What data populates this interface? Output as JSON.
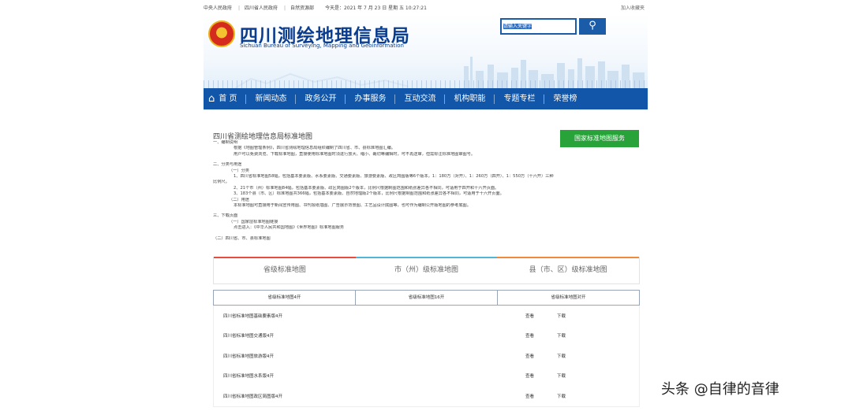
{
  "topbar": {
    "links": [
      "中央人民政府",
      "四川省人民政府",
      "自然资源部"
    ],
    "date": "今天是：2021 年 7 月 23 日 星期 五   10:27:21",
    "favorite": "加入收藏夹"
  },
  "header": {
    "title": "四川测绘地理信息局",
    "subtitle": "Sichuan Bureau of Surveying, Mapping and Geoinformation",
    "search_placeholder": "请输入关键字",
    "search_icon": "search-icon"
  },
  "nav": {
    "items": [
      "首 页",
      "新闻动态",
      "政务公开",
      "办事服务",
      "互动交流",
      "机构职能",
      "专题专栏",
      "荣誉榜"
    ]
  },
  "content": {
    "title": "四川省测绘地理信息局标准地图",
    "national_button": "国家标准地图服务",
    "lines": [
      "一、编制说明",
      "根据《地图管理条例》，四川省测绘地理信息局组织编制了四川省、市、县标准地图汇编。",
      "用户可以免费浏览、下载标准地图，直接使用标准地图时须进行放大、缩小、裁切等编辑时，可不再送审，但需标注标准地图审图号。",
      "二、分类与用途",
      "（一）分类",
      "1、四川省标准地图58幅，包括基本要素版、水系要素版、交通要素版、旅游要素版、政区简图版等6个版本，1：180万（对开）、1：260万（四开）、1：550万（十六开）三种",
      "比例尺。",
      "2、21个市（州）标准地图84幅，包括基本要素版、政区简图版2个版本，比例尺根据制图范围和纸张差异各不相同，可适用于四开和十六开页面。",
      "3、183个县（市、区）标准地图共366幅，包括基本要素版、自然地理版2个版本，比例尺根据制图范围和纸张差异各不相同，可适用于十六开页面。",
      "（二）用途",
      "本标准地图可直接用于新闻宣传用图、书刊报纸插图、广告展示背景图、工艺品设计底图等，也可作为编制公开版地图的参考底图。",
      "三、下载页面",
      "（一）国家层标准地图链接",
      "点击进入：《中华人民共和国地图》《世界地图》标准地图服务",
      "（二）四川省、市、县标准地图"
    ]
  },
  "tabs": [
    "省级标准地图",
    "市（州）级标准地图",
    "县（市、区）级标准地图"
  ],
  "table": {
    "headers": [
      "省级标准地图4开",
      "省级标准地图16开",
      "省级标准地图对开"
    ],
    "rows": [
      {
        "name": "四川省标准地图基础要素版4开",
        "view": "查看",
        "download": "下载"
      },
      {
        "name": "四川省标准地图交通版4开",
        "view": "查看",
        "download": "下载"
      },
      {
        "name": "四川省标准地图旅游版4开",
        "view": "查看",
        "download": "下载"
      },
      {
        "name": "四川省标准地图水系版4开",
        "view": "查看",
        "download": "下载"
      },
      {
        "name": "四川省标准地图政区简图版4开",
        "view": "查看",
        "download": "下载"
      }
    ]
  },
  "watermark": "头条 @自律的音律",
  "colors": {
    "nav": "#1156a8",
    "title": "#0a3d8f",
    "green_button": "#27a33a"
  }
}
